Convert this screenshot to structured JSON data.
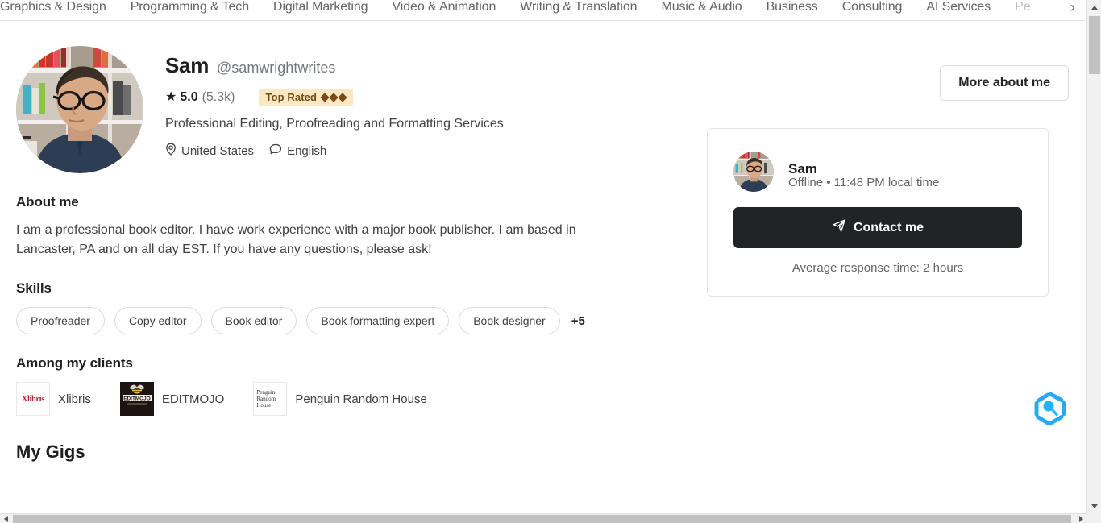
{
  "nav": {
    "items": [
      {
        "label": "Graphics & Design",
        "faded": false
      },
      {
        "label": "Programming & Tech",
        "faded": false
      },
      {
        "label": "Digital Marketing",
        "faded": false
      },
      {
        "label": "Video & Animation",
        "faded": false
      },
      {
        "label": "Writing & Translation",
        "faded": false
      },
      {
        "label": "Music & Audio",
        "faded": false
      },
      {
        "label": "Business",
        "faded": false
      },
      {
        "label": "Consulting",
        "faded": false
      },
      {
        "label": "AI Services",
        "faded": false
      },
      {
        "label": "Pe",
        "faded": true
      }
    ],
    "next_arrow_icon": "chevron-right-icon"
  },
  "profile": {
    "avatar_alt": "Sam profile photo",
    "display_name": "Sam",
    "username": "@samwrightwrites",
    "rating": "5.0",
    "rating_count": "(5.3k)",
    "star_icon": "star-icon",
    "badge": {
      "label": "Top Rated",
      "diamond_count": 3,
      "bg_color": "#fbe7c3",
      "text_color": "#6b4f17",
      "diamond_color": "#7a4b16"
    },
    "tagline": "Professional Editing, Proofreading and Formatting Services",
    "location": "United States",
    "location_icon": "location-pin-icon",
    "language": "English",
    "language_icon": "speech-bubble-icon",
    "more_about_label": "More about me"
  },
  "about": {
    "title": "About me",
    "text": "I am a professional book editor. I have work experience with a major book publisher. I am based in Lancaster, PA and on all day EST. If you have any questions, please ask!"
  },
  "skills": {
    "title": "Skills",
    "items": [
      "Proofreader",
      "Copy editor",
      "Book editor",
      "Book formatting expert",
      "Book designer"
    ],
    "more_label": "+5"
  },
  "clients": {
    "title": "Among my clients",
    "items": [
      {
        "name": "Xlibris",
        "logo": "xlibris-logo",
        "logo_text": "Xlibris"
      },
      {
        "name": "EDITMOJO",
        "logo": "editmojo-logo",
        "logo_text": "EDITMOJO"
      },
      {
        "name": "Penguin Random House",
        "logo": "penguin-random-house-logo",
        "logo_text": "Penguin Random House"
      }
    ]
  },
  "gigs": {
    "title": "My Gigs"
  },
  "contact_card": {
    "name": "Sam",
    "status": "Offline • 11:48 PM local time",
    "button_label": "Contact me",
    "button_icon": "send-plane-icon",
    "button_bg": "#222325",
    "response_time": "Average response time: 2 hours"
  },
  "float_widget": {
    "icon": "hexagon-magnifier-icon",
    "color": "#22a7f0"
  },
  "scrollbars": {
    "vertical": {
      "up_icon": "triangle-up-icon",
      "down_icon": "triangle-down-icon"
    },
    "horizontal": {
      "left_icon": "triangle-left-icon",
      "right_icon": "triangle-right-icon"
    }
  }
}
